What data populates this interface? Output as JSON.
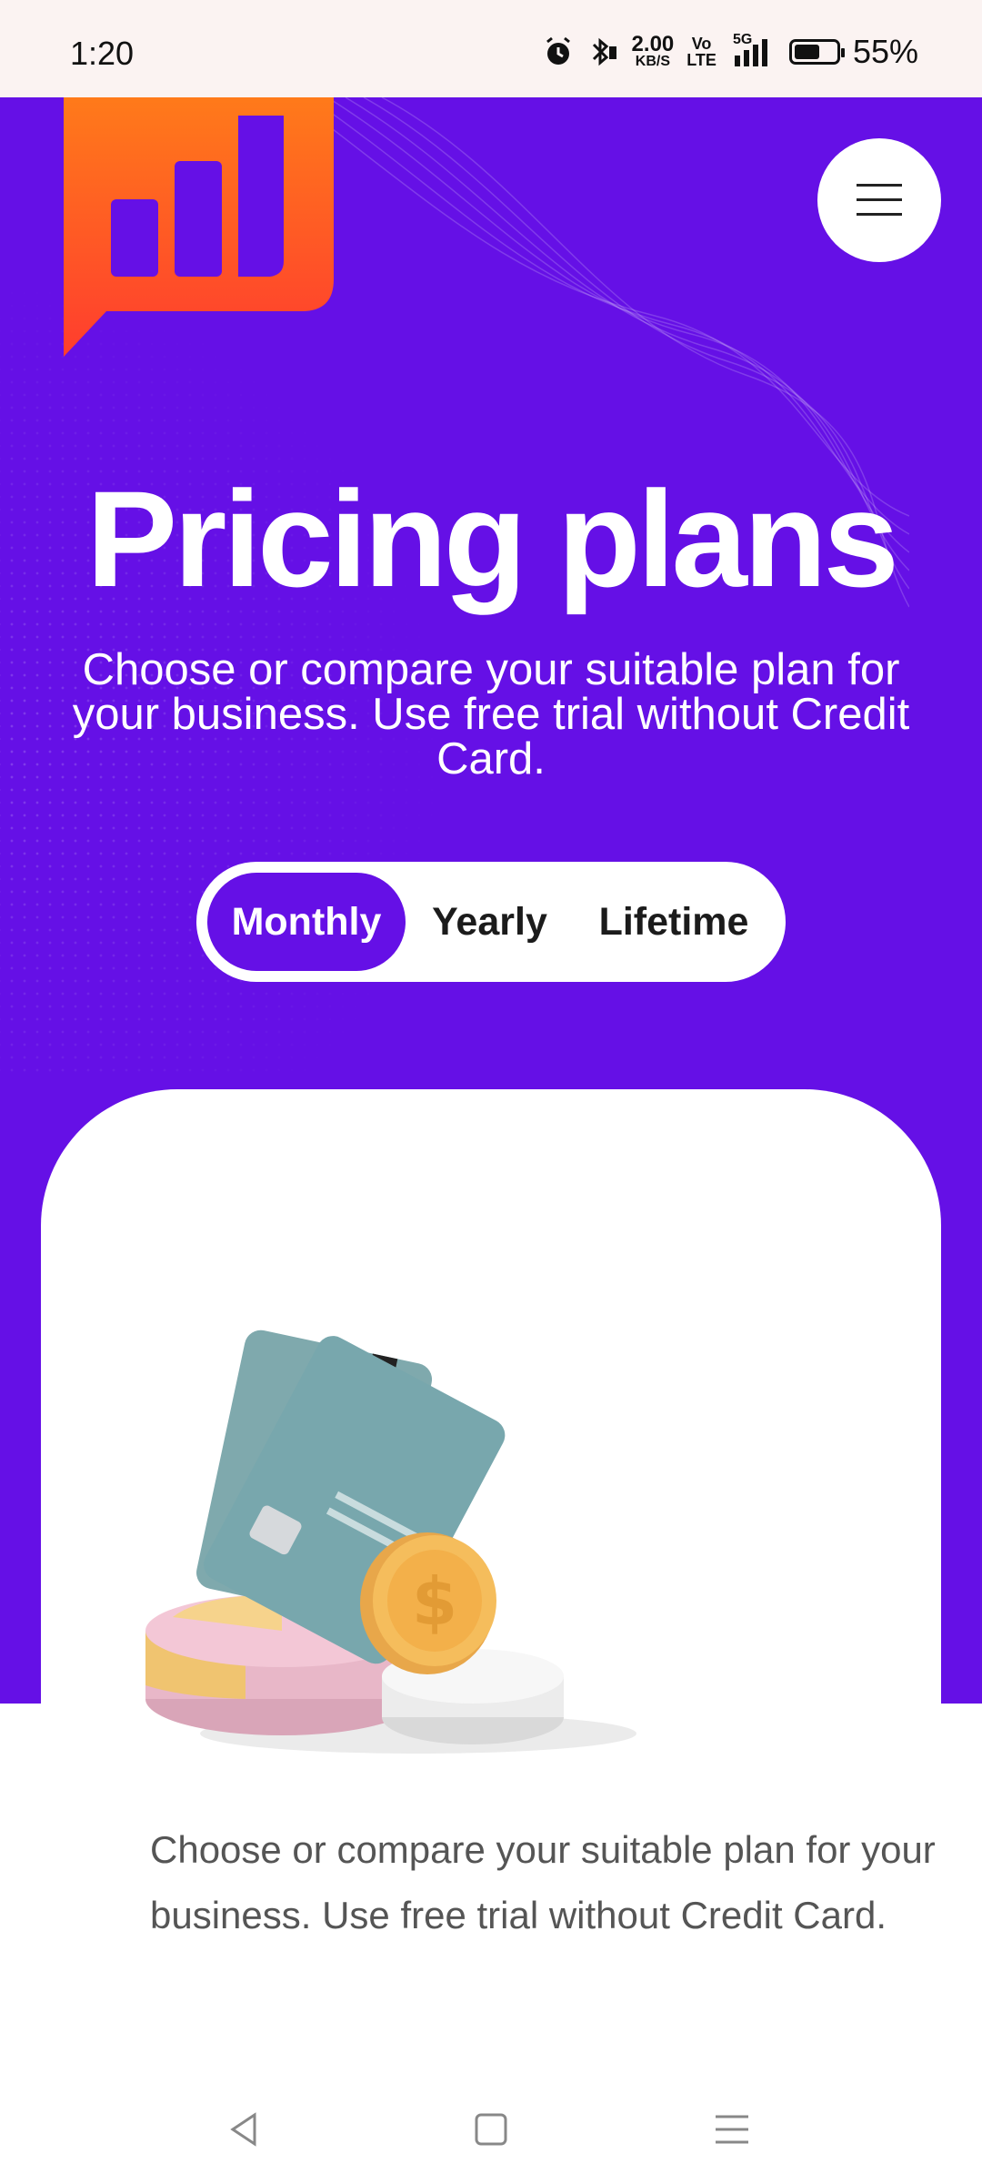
{
  "status_bar": {
    "time": "1:20",
    "net_speed_value": "2.00",
    "net_speed_unit": "KB/S",
    "volte_top": "Vo",
    "volte_bottom": "LTE",
    "network_label": "5G",
    "battery_percent": "55%",
    "icons": [
      "alarm-icon",
      "bluetooth-icon",
      "signal-icon",
      "battery-icon"
    ]
  },
  "header": {
    "logo": "bar-chart-chat-logo",
    "menu_icon": "hamburger-menu-icon"
  },
  "hero": {
    "title": "Pricing plans",
    "subtitle": "Choose or compare your suitable plan for your business. Use free trial without Credit Card.",
    "background_color": "#6510e6"
  },
  "billing_toggle": {
    "options": [
      "Monthly",
      "Yearly",
      "Lifetime"
    ],
    "selected": "Monthly"
  },
  "card": {
    "illustration": "credit-cards-and-coin-illustration",
    "description": "Choose or compare your suitable plan for your business. Use free trial without Credit Card."
  },
  "nav_bar": {
    "icons": [
      "back-icon",
      "home-icon",
      "recents-icon"
    ]
  },
  "colors": {
    "accent": "#6510e6",
    "logo_orange": "#ff5a1f",
    "status_bar_bg": "#fbf3f2"
  }
}
